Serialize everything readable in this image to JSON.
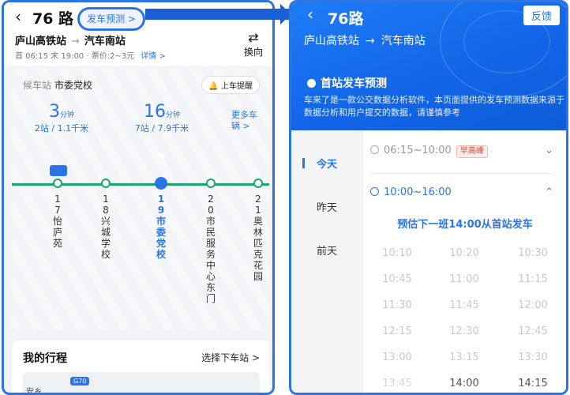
{
  "left": {
    "title": "76 路",
    "predict_button": "发车预测 >",
    "route_from": "庐山高铁站",
    "route_to": "汽车南站",
    "route_arrow": "→",
    "info": "首 06:15 末 19:00 · 票价:2~3元",
    "info_more": "详情 >",
    "swap_label": "换向",
    "waiting_label": "候车站",
    "waiting_station": "市委党校",
    "remind_label": "上车提醒",
    "bus1": {
      "count": "3",
      "unit": "分钟",
      "detail": "2站 / 1.1千米"
    },
    "bus2": {
      "count": "16",
      "unit": "分钟",
      "detail": "7站 / 7.9千米"
    },
    "more_buses": "更多车辆 >",
    "stops": [
      {
        "num": "17",
        "name": "怡庐苑"
      },
      {
        "num": "18",
        "name": "兴城学校"
      },
      {
        "num": "19",
        "name": "市委党校"
      },
      {
        "num": "20",
        "name": "市民服务中心东门"
      },
      {
        "num": "21",
        "name": "奥林匹克花园"
      }
    ],
    "trip_title": "我的行程",
    "trip_select": "选择下车站 >",
    "map_label": "安乡",
    "map_road": "G70"
  },
  "right": {
    "title": "76路",
    "feedback": "反馈",
    "route_from": "庐山高铁站",
    "route_to": "汽车南站",
    "route_arrow": "→",
    "pred_title": "首站发车预测",
    "pred_desc": "车来了是一款公交数据分析软件，本页面提供的发车预测数据来源于数据分析和用户提交的数据，请谨慎参考",
    "days": [
      "今天",
      "昨天",
      "前天"
    ],
    "slot1": {
      "range": "06:15~10:00",
      "badge": "早高峰"
    },
    "slot2": {
      "range": "10:00~16:00"
    },
    "next_bus": "预估下一班14:00从首站发车",
    "times": [
      [
        "10:10",
        "10:20",
        "10:30"
      ],
      [
        "10:45",
        "11:00",
        "11:15"
      ],
      [
        "11:30",
        "11:45",
        "12:00"
      ],
      [
        "12:15",
        "12:30",
        "12:45"
      ],
      [
        "13:00",
        "13:15",
        "13:30"
      ],
      [
        "13:45",
        "14:00",
        "14:15"
      ]
    ],
    "highlight_times": [
      "14:00",
      "14:15"
    ]
  },
  "colors": {
    "accent": "#2a74e6",
    "route_line": "#1aa86a",
    "peak": "#e0462b"
  },
  "icons": [
    "back-arrow-icon",
    "swap-icon",
    "bell-icon",
    "bus-icon",
    "clock-icon",
    "chevron-icon"
  ]
}
